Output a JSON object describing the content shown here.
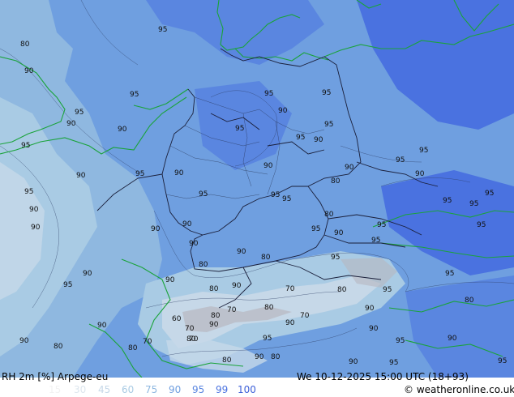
{
  "title_left": "RH 2m [%] Arpege-eu",
  "title_right": "We 10-12-2025 15:00 UTC (18+93)",
  "credit": "© weatheronline.co.uk",
  "legend": [
    {
      "label": "15",
      "color": "#f2f2f2"
    },
    {
      "label": "30",
      "color": "#dde6ee"
    },
    {
      "label": "45",
      "color": "#c6d8e8"
    },
    {
      "label": "60",
      "color": "#a9cbe4"
    },
    {
      "label": "75",
      "color": "#8fb8e0"
    },
    {
      "label": "90",
      "color": "#6f9fe0"
    },
    {
      "label": "95",
      "color": "#5a86e0"
    },
    {
      "label": "99",
      "color": "#4a72e0"
    },
    {
      "label": "100",
      "color": "#3d60d8"
    }
  ],
  "contour_labels": [
    "95",
    "80",
    "90",
    "95",
    "95",
    "90",
    "90",
    "95",
    "95",
    "90",
    "95",
    "90",
    "90",
    "95",
    "95",
    "95",
    "90",
    "95",
    "95",
    "90",
    "90",
    "95",
    "80",
    "95",
    "95",
    "90",
    "90",
    "95",
    "90",
    "90",
    "95",
    "95",
    "95",
    "80",
    "90",
    "95",
    "90",
    "95",
    "95",
    "95",
    "90",
    "90",
    "95",
    "80",
    "90",
    "90",
    "95",
    "95",
    "80",
    "95",
    "70",
    "80",
    "90",
    "80",
    "80",
    "80",
    "70",
    "60",
    "70",
    "80",
    "70",
    "90",
    "95",
    "70",
    "90",
    "80",
    "90",
    "95",
    "90",
    "70",
    "90",
    "80",
    "90",
    "95",
    "90",
    "95",
    "90",
    "90",
    "95",
    "80",
    "80",
    "80"
  ]
}
